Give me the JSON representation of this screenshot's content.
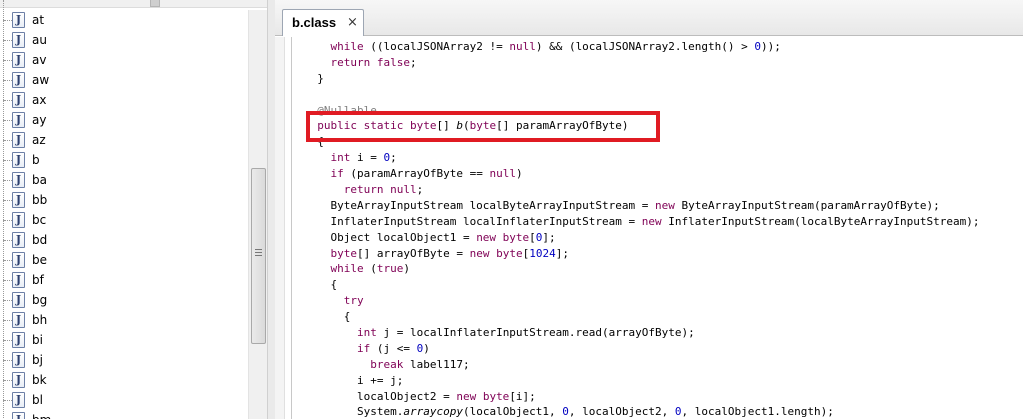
{
  "tree": {
    "items": [
      {
        "label": "at"
      },
      {
        "label": "au"
      },
      {
        "label": "av"
      },
      {
        "label": "aw"
      },
      {
        "label": "ax"
      },
      {
        "label": "ay"
      },
      {
        "label": "az"
      },
      {
        "label": "b"
      },
      {
        "label": "ba"
      },
      {
        "label": "bb"
      },
      {
        "label": "bc"
      },
      {
        "label": "bd"
      },
      {
        "label": "be"
      },
      {
        "label": "bf"
      },
      {
        "label": "bg"
      },
      {
        "label": "bh"
      },
      {
        "label": "bi"
      },
      {
        "label": "bj"
      },
      {
        "label": "bk"
      },
      {
        "label": "bl"
      },
      {
        "label": "bm"
      }
    ],
    "item_icon_letter": "J",
    "item_icon": "java-class-file-icon"
  },
  "editor": {
    "tab_label": "b.class",
    "tab_close": "×",
    "highlight_color": "#e01b23",
    "code_lines": [
      [
        {
          "t": "    "
        },
        {
          "t": "while",
          "c": "kw"
        },
        {
          "t": " ((localJSONArray2 != "
        },
        {
          "t": "null",
          "c": "kw"
        },
        {
          "t": ") && (localJSONArray2.length() > "
        },
        {
          "t": "0",
          "c": "num"
        },
        {
          "t": "));"
        }
      ],
      [
        {
          "t": "    "
        },
        {
          "t": "return false",
          "c": "kw"
        },
        {
          "t": ";"
        }
      ],
      [
        {
          "t": "  }"
        }
      ],
      [
        {
          "t": ""
        }
      ],
      [
        {
          "t": "  "
        },
        {
          "t": "@Nullable",
          "c": "ann"
        }
      ],
      [
        {
          "t": "  "
        },
        {
          "t": "public static byte",
          "c": "kw"
        },
        {
          "t": "[] "
        },
        {
          "t": "b",
          "c": "ital"
        },
        {
          "t": "("
        },
        {
          "t": "byte",
          "c": "kw"
        },
        {
          "t": "[] paramArrayOfByte)"
        }
      ],
      [
        {
          "t": "  {"
        }
      ],
      [
        {
          "t": "    "
        },
        {
          "t": "int",
          "c": "kw"
        },
        {
          "t": " i = "
        },
        {
          "t": "0",
          "c": "num"
        },
        {
          "t": ";"
        }
      ],
      [
        {
          "t": "    "
        },
        {
          "t": "if",
          "c": "kw"
        },
        {
          "t": " (paramArrayOfByte == "
        },
        {
          "t": "null",
          "c": "kw"
        },
        {
          "t": ")"
        }
      ],
      [
        {
          "t": "      "
        },
        {
          "t": "return null",
          "c": "kw"
        },
        {
          "t": ";"
        }
      ],
      [
        {
          "t": "    ByteArrayInputStream localByteArrayInputStream = "
        },
        {
          "t": "new",
          "c": "kw"
        },
        {
          "t": " ByteArrayInputStream(paramArrayOfByte);"
        }
      ],
      [
        {
          "t": "    InflaterInputStream localInflaterInputStream = "
        },
        {
          "t": "new",
          "c": "kw"
        },
        {
          "t": " InflaterInputStream(localByteArrayInputStream);"
        }
      ],
      [
        {
          "t": "    Object localObject1 = "
        },
        {
          "t": "new byte",
          "c": "kw"
        },
        {
          "t": "["
        },
        {
          "t": "0",
          "c": "num"
        },
        {
          "t": "];"
        }
      ],
      [
        {
          "t": "    "
        },
        {
          "t": "byte",
          "c": "kw"
        },
        {
          "t": "[] arrayOfByte = "
        },
        {
          "t": "new byte",
          "c": "kw"
        },
        {
          "t": "["
        },
        {
          "t": "1024",
          "c": "num"
        },
        {
          "t": "];"
        }
      ],
      [
        {
          "t": "    "
        },
        {
          "t": "while",
          "c": "kw"
        },
        {
          "t": " ("
        },
        {
          "t": "true",
          "c": "kw"
        },
        {
          "t": ")"
        }
      ],
      [
        {
          "t": "    {"
        }
      ],
      [
        {
          "t": "      "
        },
        {
          "t": "try",
          "c": "kw"
        }
      ],
      [
        {
          "t": "      {"
        }
      ],
      [
        {
          "t": "        "
        },
        {
          "t": "int",
          "c": "kw"
        },
        {
          "t": " j = localInflaterInputStream.read(arrayOfByte);"
        }
      ],
      [
        {
          "t": "        "
        },
        {
          "t": "if",
          "c": "kw"
        },
        {
          "t": " (j <= "
        },
        {
          "t": "0",
          "c": "num"
        },
        {
          "t": ")"
        }
      ],
      [
        {
          "t": "          "
        },
        {
          "t": "break",
          "c": "kw"
        },
        {
          "t": " label117;"
        }
      ],
      [
        {
          "t": "        i += j;"
        }
      ],
      [
        {
          "t": "        localObject2 = "
        },
        {
          "t": "new byte",
          "c": "kw"
        },
        {
          "t": "[i];"
        }
      ],
      [
        {
          "t": "        System."
        },
        {
          "t": "arraycopy",
          "c": "ital"
        },
        {
          "t": "(localObject1, "
        },
        {
          "t": "0",
          "c": "num"
        },
        {
          "t": ", localObject2, "
        },
        {
          "t": "0",
          "c": "num"
        },
        {
          "t": ", localObject1.length);"
        }
      ]
    ]
  }
}
